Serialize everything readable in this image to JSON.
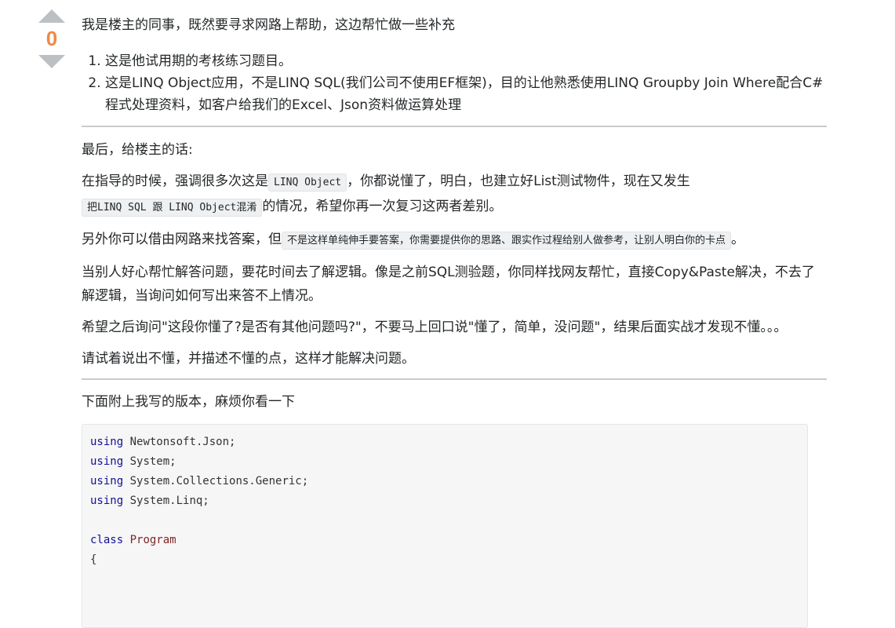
{
  "vote": {
    "score": "0"
  },
  "post": {
    "intro": "我是楼主的同事，既然要寻求网路上帮助，这边帮忙做一些补充",
    "list": [
      "这是他试用期的考核练习题目。",
      "这是LINQ Object应用，不是LINQ SQL(我们公司不使用EF框架)，目的让他熟悉使用LINQ Groupby Join Where配合C#程式处理资料，如客户给我们的Excel、Json资料做运算处理"
    ],
    "closing_heading": "最后，给楼主的话:",
    "p1": {
      "before": "在指导的时候，强调很多次这是",
      "code1": "LINQ Object",
      "middle": "，你都说懂了，明白，也建立好List测试物件，现在又发生",
      "code2": "把LINQ SQL 跟 LINQ Object混淆",
      "after": "的情况，希望你再一次复习这两者差别。"
    },
    "p2": {
      "before": "另外你可以借由网路来找答案，但",
      "code": "不是这样单纯伸手要答案，你需要提供你的思路、跟实作过程给别人做参考，让别人明白你的卡点",
      "after": "。"
    },
    "p3": "当别人好心帮忙解答问题，要花时间去了解逻辑。像是之前SQL测验题，你同样找网友帮忙，直接Copy&Paste解决，不去了解逻辑，当询问如何写出来答不上情况。",
    "p4": "希望之后询问\"这段你懂了?是否有其他问题吗?\"，不要马上回口说\"懂了，简单，没问题\"，结果后面实战才发现不懂。。。",
    "p5": "请试着说出不懂，并描述不懂的点，这样才能解决问题。",
    "attach": "下面附上我写的版本，麻烦你看一下",
    "code": {
      "kw_using": "using",
      "ns1": " Newtonsoft.Json;",
      "ns2": " System;",
      "ns3": " System.Collections.Generic;",
      "ns4": " System.Linq;",
      "kw_class": "class",
      "class_name": "Program",
      "brace": "{"
    }
  }
}
